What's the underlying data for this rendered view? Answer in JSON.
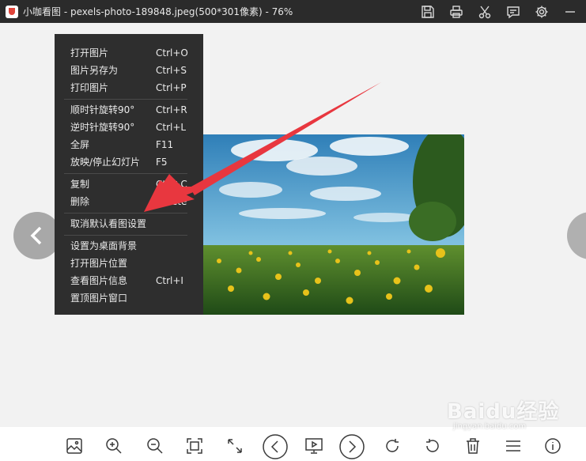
{
  "window": {
    "title": "小咖看图 - pexels-photo-189848.jpeg(500*301像素) - 76%"
  },
  "titlebar_icons": [
    "save-icon",
    "print-icon",
    "scissors-icon",
    "comment-icon",
    "settings-icon",
    "minimize-icon"
  ],
  "context_menu": {
    "items": [
      {
        "label": "打开图片",
        "shortcut": "Ctrl+O"
      },
      {
        "label": "图片另存为",
        "shortcut": "Ctrl+S"
      },
      {
        "label": "打印图片",
        "shortcut": "Ctrl+P"
      },
      {
        "label": "顺时针旋转90°",
        "shortcut": "Ctrl+R"
      },
      {
        "label": "逆时针旋转90°",
        "shortcut": "Ctrl+L"
      },
      {
        "label": "全屏",
        "shortcut": "F11"
      },
      {
        "label": "放映/停止幻灯片",
        "shortcut": "F5"
      },
      {
        "label": "复制",
        "shortcut": "Ctrl+C"
      },
      {
        "label": "删除",
        "shortcut": "Delete"
      },
      {
        "label": "取消默认看图设置",
        "shortcut": ""
      },
      {
        "label": "设置为桌面背景",
        "shortcut": ""
      },
      {
        "label": "打开图片位置",
        "shortcut": ""
      },
      {
        "label": "查看图片信息",
        "shortcut": "Ctrl+I"
      },
      {
        "label": "置顶图片窗口",
        "shortcut": ""
      }
    ]
  },
  "bottom_toolbar": [
    "image-icon",
    "zoom-in-icon",
    "zoom-out-icon",
    "fit-screen-icon",
    "expand-icon",
    "previous-icon",
    "slideshow-icon",
    "next-icon",
    "rotate-clockwise-icon",
    "rotate-counterclockwise-icon",
    "delete-icon",
    "menu-icon",
    "info-icon"
  ],
  "watermark": {
    "main": "Baidu经验",
    "sub": "jingyan.baidu.com"
  },
  "colors": {
    "titlebar": "#2b2b2b",
    "menu_bg": "#2e2e2e",
    "canvas_bg": "#f2f2f2",
    "arrow": "#e8373f"
  }
}
